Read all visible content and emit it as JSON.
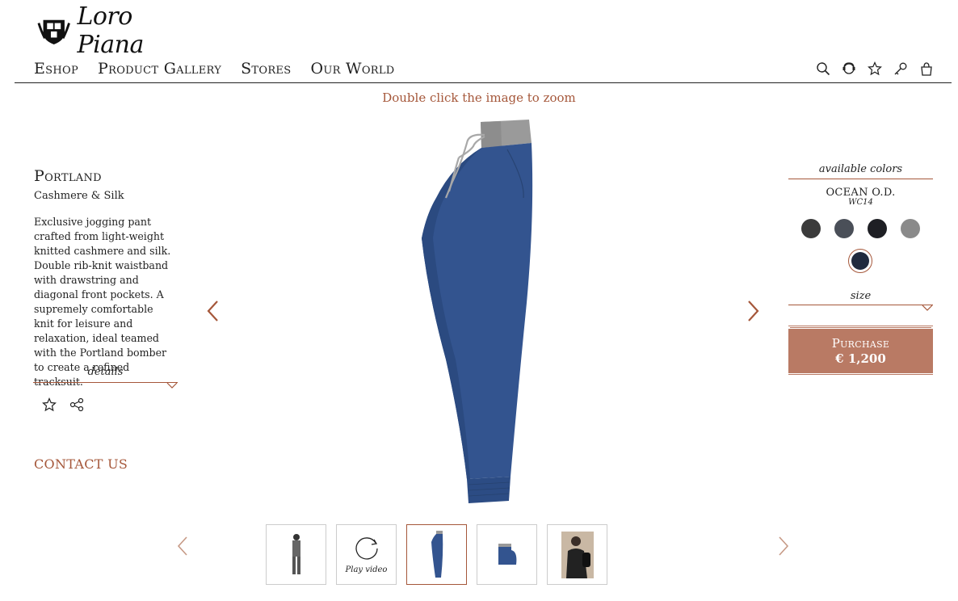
{
  "brand": {
    "name": "Loro Piana"
  },
  "nav": {
    "items": [
      "Eshop",
      "Product Gallery",
      "Stores",
      "Our World"
    ]
  },
  "header_icons": [
    "search-icon",
    "assistant-icon",
    "star-icon",
    "key-icon",
    "bag-icon"
  ],
  "zoom_hint": "Double click the image to zoom",
  "product": {
    "name": "Portland",
    "material": "Cashmere & Silk",
    "description": "Exclusive jogging pant crafted from light-weight knitted cashmere and silk. Double rib-knit waistband with drawstring and diagonal front pockets. A supremely comfortable knit for leisure and relaxation, ideal teamed with the Portland bomber to create a refined tracksuit.",
    "details_label": "details",
    "contact_label": "CONTACT US"
  },
  "options": {
    "available_colors_label": "available colors",
    "selected_color_name": "OCEAN O.D.",
    "selected_color_code": "WC14",
    "swatches": [
      {
        "color": "#3b3b3b"
      },
      {
        "color": "#4a4f58"
      },
      {
        "color": "#1e1f24"
      },
      {
        "color": "#8a8a8a"
      },
      {
        "color": "#202a3e",
        "selected": true
      }
    ],
    "size_label": "size"
  },
  "purchase": {
    "label": "Purchase",
    "price": "€ 1,200"
  },
  "thumbnails": [
    {
      "type": "model-full"
    },
    {
      "type": "video",
      "label": "Play video"
    },
    {
      "type": "pants-side",
      "selected": true
    },
    {
      "type": "pants-folded"
    },
    {
      "type": "model-close"
    }
  ],
  "colors": {
    "accent": "#a5573a",
    "purchase_bg": "#b97a64",
    "pants": "#33548f",
    "rib": "#9a9a9a"
  }
}
